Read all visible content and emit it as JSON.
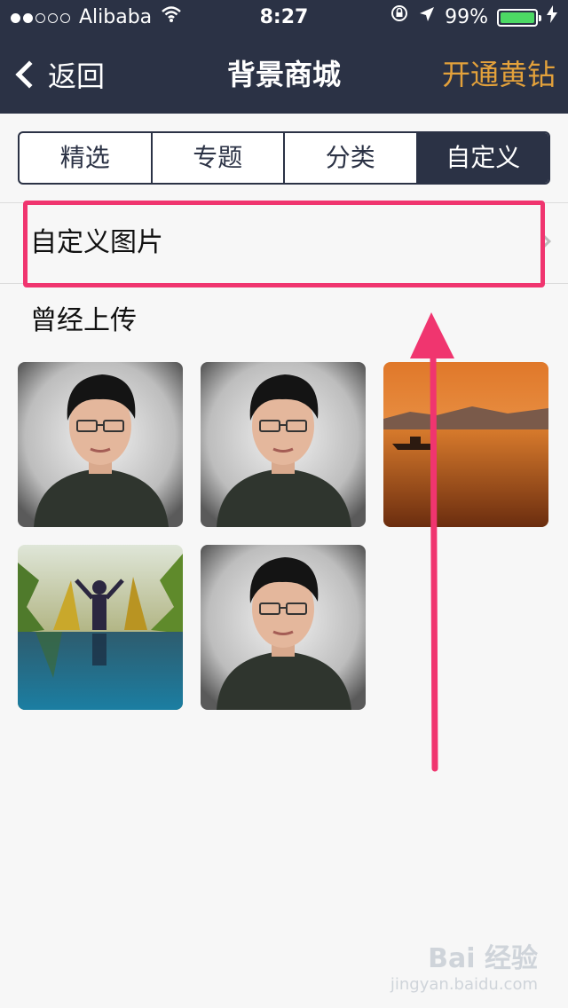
{
  "status_bar": {
    "carrier": "Alibaba",
    "time": "8:27",
    "battery_percent": "99%",
    "battery_level": 0.99,
    "signal_dots_filled": 2,
    "signal_dots_total": 5
  },
  "nav": {
    "back_label": "返回",
    "title": "背景商城",
    "vip_label": "开通黄钻"
  },
  "tabs": [
    {
      "label": "精选",
      "active": false
    },
    {
      "label": "专题",
      "active": false
    },
    {
      "label": "分类",
      "active": false
    },
    {
      "label": "自定义",
      "active": true
    }
  ],
  "custom_row": {
    "label": "自定义图片"
  },
  "uploaded": {
    "title": "曾经上传",
    "thumbnails": [
      {
        "kind": "portrait"
      },
      {
        "kind": "portrait"
      },
      {
        "kind": "sunset"
      },
      {
        "kind": "field"
      },
      {
        "kind": "portrait"
      }
    ]
  },
  "watermark": {
    "brand": "Bai 经验",
    "site": "jingyan.baidu.com"
  },
  "colors": {
    "navbar": "#2b3245",
    "accent": "#e3a13b",
    "annotation": "#f0356f"
  }
}
